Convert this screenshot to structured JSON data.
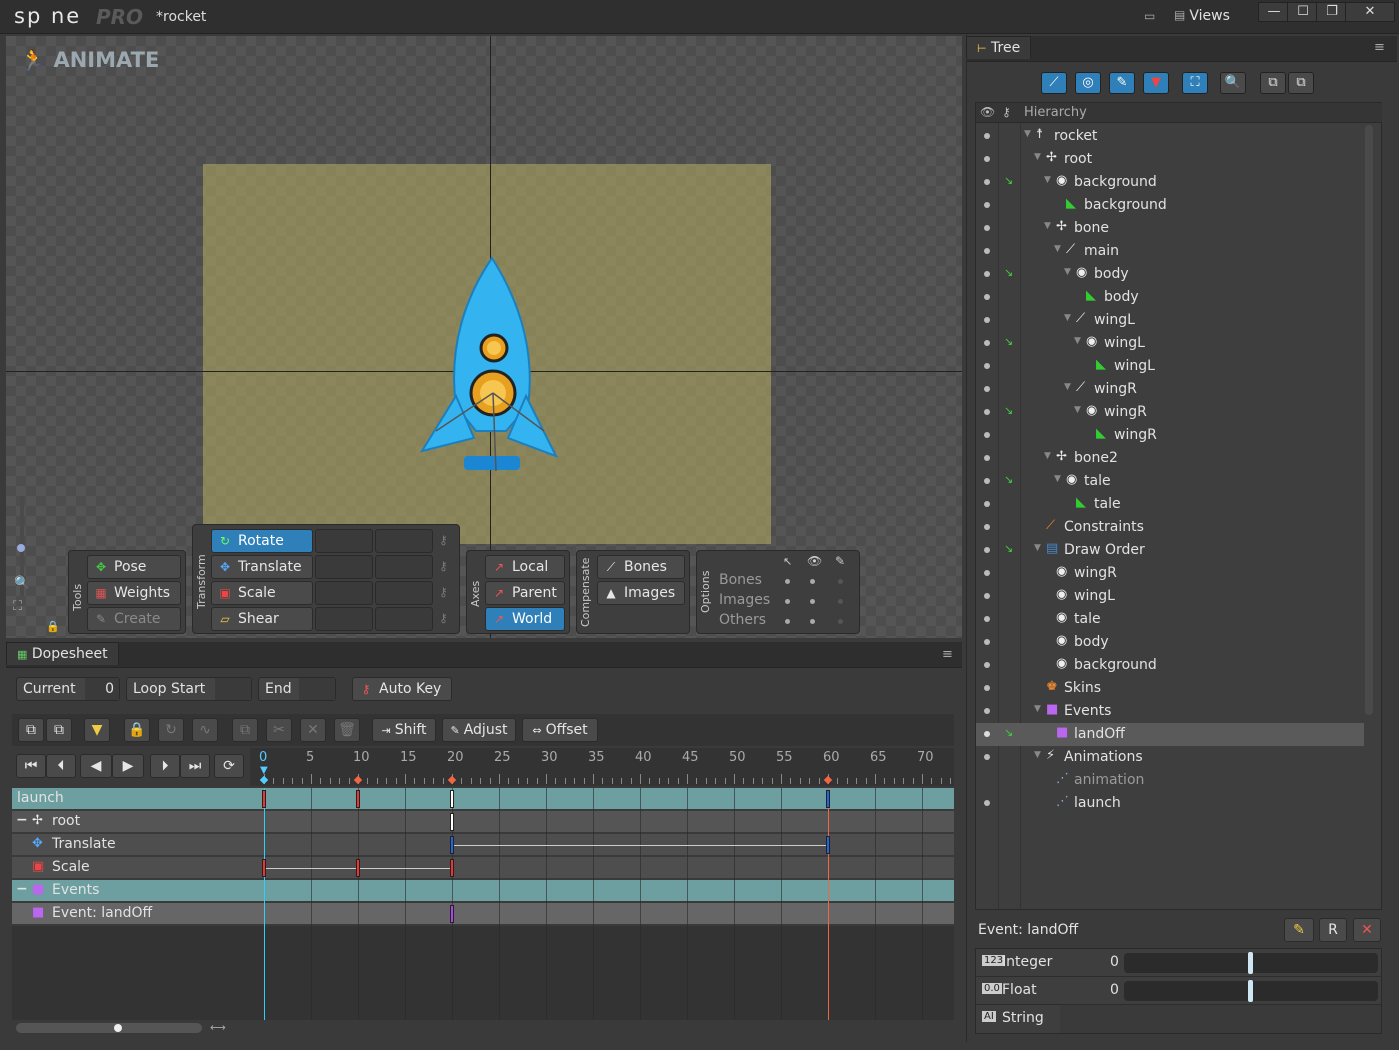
{
  "app": {
    "logo": "sp ne",
    "edition": "PRO",
    "document": "*rocket",
    "views_label": "Views",
    "min": "—",
    "max": "☐",
    "restore": "❐",
    "close": "✕"
  },
  "viewport": {
    "mode_label": "ANIMATE"
  },
  "tools": {
    "group": "Tools",
    "pose": "Pose",
    "weights": "Weights",
    "create": "Create"
  },
  "transform": {
    "group": "Transform",
    "rotate": "Rotate",
    "translate": "Translate",
    "scale": "Scale",
    "shear": "Shear"
  },
  "axes": {
    "group": "Axes",
    "local": "Local",
    "parent": "Parent",
    "world": "World"
  },
  "compensate": {
    "group": "Compensate",
    "bones": "Bones",
    "images": "Images"
  },
  "options": {
    "group": "Options",
    "rows": [
      "Bones",
      "Images",
      "Others"
    ]
  },
  "dopesheet": {
    "tab": "Dopesheet",
    "current_label": "Current",
    "current_value": "0",
    "loop_start_label": "Loop Start",
    "end_label": "End",
    "auto_key": "Auto Key",
    "shift": "Shift",
    "adjust": "Adjust",
    "offset": "Offset",
    "ticks": [
      "0",
      "5",
      "10",
      "15",
      "20",
      "25",
      "30",
      "35",
      "40",
      "45",
      "50",
      "55",
      "60",
      "65",
      "70"
    ],
    "rows": [
      {
        "label": "launch",
        "kind": "anim"
      },
      {
        "label": "root",
        "kind": "bone"
      },
      {
        "label": "Translate",
        "kind": "timeline"
      },
      {
        "label": "Scale",
        "kind": "timeline"
      },
      {
        "label": "Events",
        "kind": "anim"
      },
      {
        "label": "Event: landOff",
        "kind": "event"
      }
    ]
  },
  "tree": {
    "tab": "Tree",
    "header": "Hierarchy",
    "items": [
      {
        "label": "rocket",
        "icon": "skeleton-icon",
        "depth": 0
      },
      {
        "label": "root",
        "icon": "bone-icon",
        "depth": 1
      },
      {
        "label": "background",
        "icon": "slot-icon",
        "depth": 2
      },
      {
        "label": "background",
        "icon": "image-icon",
        "depth": 3
      },
      {
        "label": "bone",
        "icon": "bone-icon",
        "depth": 2
      },
      {
        "label": "main",
        "icon": "bone-edit-icon",
        "depth": 3
      },
      {
        "label": "body",
        "icon": "slot-icon",
        "depth": 4
      },
      {
        "label": "body",
        "icon": "image-icon",
        "depth": 5
      },
      {
        "label": "wingL",
        "icon": "bone-edit-icon",
        "depth": 4
      },
      {
        "label": "wingL",
        "icon": "slot-icon",
        "depth": 5
      },
      {
        "label": "wingL",
        "icon": "image-icon",
        "depth": 6
      },
      {
        "label": "wingR",
        "icon": "bone-edit-icon",
        "depth": 4
      },
      {
        "label": "wingR",
        "icon": "slot-icon",
        "depth": 5
      },
      {
        "label": "wingR",
        "icon": "image-icon",
        "depth": 6
      },
      {
        "label": "bone2",
        "icon": "bone-icon",
        "depth": 2
      },
      {
        "label": "tale",
        "icon": "slot-icon",
        "depth": 3
      },
      {
        "label": "tale",
        "icon": "image-icon",
        "depth": 4
      },
      {
        "label": "Constraints",
        "icon": "constraint-icon",
        "depth": 1
      },
      {
        "label": "Draw Order",
        "icon": "draw-order-icon",
        "depth": 1
      },
      {
        "label": "wingR",
        "icon": "slot-icon",
        "depth": 2
      },
      {
        "label": "wingL",
        "icon": "slot-icon",
        "depth": 2
      },
      {
        "label": "tale",
        "icon": "slot-icon",
        "depth": 2
      },
      {
        "label": "body",
        "icon": "slot-icon",
        "depth": 2
      },
      {
        "label": "background",
        "icon": "slot-icon",
        "depth": 2
      },
      {
        "label": "Skins",
        "icon": "skins-icon",
        "depth": 1
      },
      {
        "label": "Events",
        "icon": "events-icon",
        "depth": 1
      },
      {
        "label": "landOff",
        "icon": "event-icon",
        "depth": 2
      },
      {
        "label": "Animations",
        "icon": "animations-icon",
        "depth": 1
      },
      {
        "label": "animation",
        "icon": "animation-icon",
        "depth": 2
      },
      {
        "label": "launch",
        "icon": "animation-icon",
        "depth": 2
      }
    ]
  },
  "properties": {
    "title": "Event: landOff",
    "integer_label": "Integer",
    "integer_value": "0",
    "float_label": "Float",
    "float_value": "0",
    "string_label": "String"
  }
}
